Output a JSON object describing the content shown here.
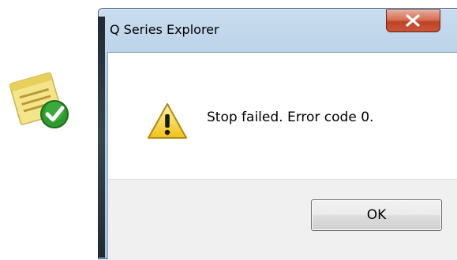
{
  "desktop": {
    "icon": "notepad-check-icon"
  },
  "dialog": {
    "title": "Q Series Explorer",
    "close_icon": "close-icon",
    "icon": "warning-icon",
    "message": "Stop failed. Error code 0.",
    "ok_label": "OK",
    "colors": {
      "close_button": "#c8573b",
      "frame": "#b7d0e7",
      "footer": "#f0f0f0"
    }
  }
}
